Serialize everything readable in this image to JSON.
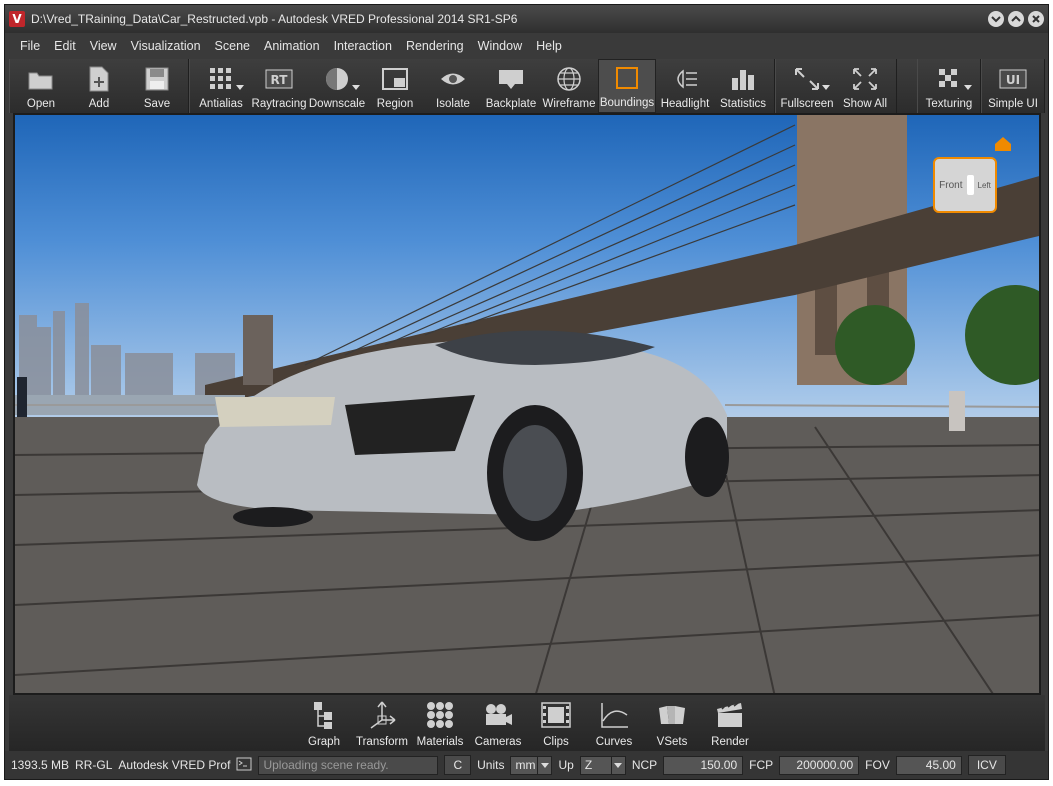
{
  "window": {
    "title": "D:\\Vred_TRaining_Data\\Car_Restructed.vpb - Autodesk VRED Professional 2014 SR1-SP6",
    "logo_letter": "V"
  },
  "menu": [
    "File",
    "Edit",
    "View",
    "Visualization",
    "Scene",
    "Animation",
    "Interaction",
    "Rendering",
    "Window",
    "Help"
  ],
  "toolbar": {
    "groups": [
      [
        {
          "label": "Open",
          "icon": "folder-icon"
        },
        {
          "label": "Add",
          "icon": "add-file-icon"
        },
        {
          "label": "Save",
          "icon": "save-icon"
        }
      ],
      [
        {
          "label": "Antialias",
          "icon": "antialias-icon"
        },
        {
          "label": "Raytracing",
          "icon": "rt-icon"
        },
        {
          "label": "Downscale",
          "icon": "downscale-icon"
        },
        {
          "label": "Region",
          "icon": "region-icon"
        },
        {
          "label": "Isolate",
          "icon": "eye-icon"
        },
        {
          "label": "Backplate",
          "icon": "backplate-icon"
        },
        {
          "label": "Wireframe",
          "icon": "wireframe-icon"
        },
        {
          "label": "Boundings",
          "icon": "boundings-icon"
        },
        {
          "label": "Headlight",
          "icon": "headlight-icon"
        },
        {
          "label": "Statistics",
          "icon": "statistics-icon"
        }
      ],
      [
        {
          "label": "Fullscreen",
          "icon": "fullscreen-icon"
        },
        {
          "label": "Show All",
          "icon": "show-all-icon"
        }
      ],
      [
        {
          "label": "Texturing",
          "icon": "texturing-icon"
        }
      ],
      [
        {
          "label": "Simple UI",
          "icon": "simple-ui-icon"
        }
      ]
    ],
    "active": "Boundings"
  },
  "viewport": {
    "navcube_face": "Front",
    "navcube_side": "Left",
    "accent": "#f08a00"
  },
  "bottom_toolbar": [
    {
      "label": "Graph",
      "icon": "graph-icon"
    },
    {
      "label": "Transform",
      "icon": "transform-icon"
    },
    {
      "label": "Materials",
      "icon": "materials-icon"
    },
    {
      "label": "Cameras",
      "icon": "camera-icon"
    },
    {
      "label": "Clips",
      "icon": "clips-icon"
    },
    {
      "label": "Curves",
      "icon": "curves-icon"
    },
    {
      "label": "VSets",
      "icon": "vsets-icon"
    },
    {
      "label": "Render",
      "icon": "render-icon"
    }
  ],
  "status": {
    "memory": "1393.5 MB",
    "renderer": "RR-GL",
    "app": "Autodesk VRED Prof",
    "log_placeholder": "Uploading scene ready.",
    "clear_label": "C",
    "units_label": "Units",
    "units_value": "mm",
    "up_label": "Up",
    "up_value": "Z",
    "ncp_label": "NCP",
    "ncp_value": "150.00",
    "fcp_label": "FCP",
    "fcp_value": "200000.00",
    "fov_label": "FOV",
    "fov_value": "45.00",
    "icv_label": "ICV"
  }
}
